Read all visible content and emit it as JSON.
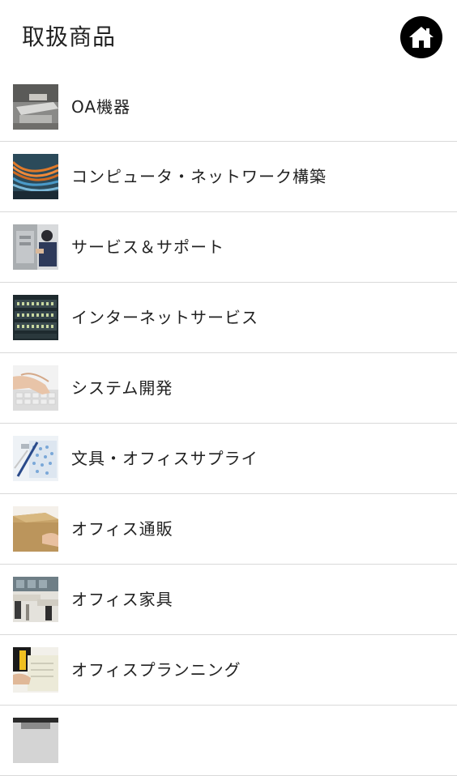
{
  "header": {
    "title": "取扱商品",
    "home_icon": "home-icon"
  },
  "items": [
    {
      "label": "OA機器",
      "icon": "copier-photo"
    },
    {
      "label": "コンピュータ・ネットワーク構築",
      "icon": "network-cables-photo"
    },
    {
      "label": "サービス＆サポート",
      "icon": "technician-photo"
    },
    {
      "label": "インターネットサービス",
      "icon": "server-rack-photo"
    },
    {
      "label": "システム開発",
      "icon": "keyboard-typing-photo"
    },
    {
      "label": "文具・オフィスサプライ",
      "icon": "stationery-photo"
    },
    {
      "label": "オフィス通販",
      "icon": "cardboard-box-photo"
    },
    {
      "label": "オフィス家具",
      "icon": "office-desks-photo"
    },
    {
      "label": "オフィスプランニング",
      "icon": "planning-documents-photo"
    }
  ],
  "colors": {
    "divider": "#d9d9d9",
    "text": "#222222",
    "home_button": "#000000"
  }
}
